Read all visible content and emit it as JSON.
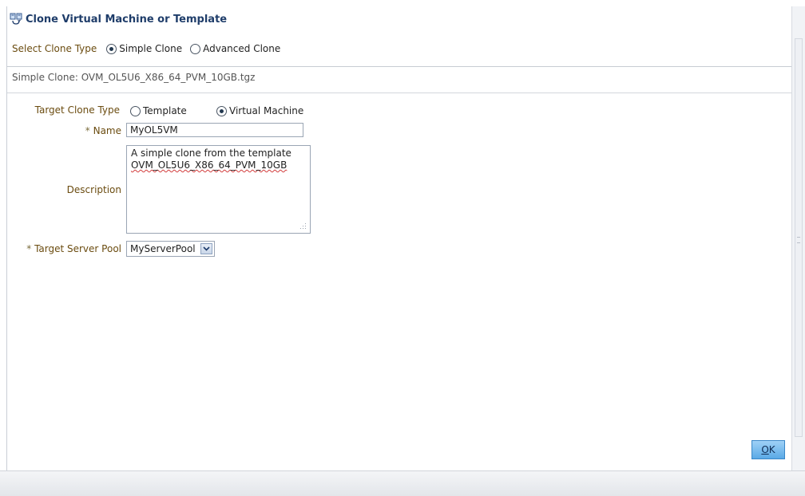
{
  "dialog": {
    "title": "Clone Virtual Machine or Template",
    "title_icon": "clone-icon"
  },
  "clone_type": {
    "label": "Select Clone Type",
    "options": [
      "Simple Clone",
      "Advanced Clone"
    ],
    "selected": "Simple Clone"
  },
  "summary": "Simple Clone: OVM_OL5U6_X86_64_PVM_10GB.tgz",
  "target_clone_type": {
    "label": "Target Clone Type",
    "options": [
      "Template",
      "Virtual Machine"
    ],
    "selected": "Virtual Machine"
  },
  "name": {
    "label": "Name",
    "required_mark": "*",
    "value": "MyOL5VM"
  },
  "description": {
    "label": "Description",
    "line1": "A simple clone from the template",
    "line2": "OVM_OL5U6_X86_64_PVM_10GB"
  },
  "target_server_pool": {
    "label": "Target Server Pool",
    "required_mark": "*",
    "value": "MyServerPool"
  },
  "ok_button": {
    "mnemonic": "O",
    "rest": "K"
  },
  "colors": {
    "label_text": "#6b4c10",
    "title_text": "#1f3d6a",
    "ok_button": "#5aa9e6"
  }
}
